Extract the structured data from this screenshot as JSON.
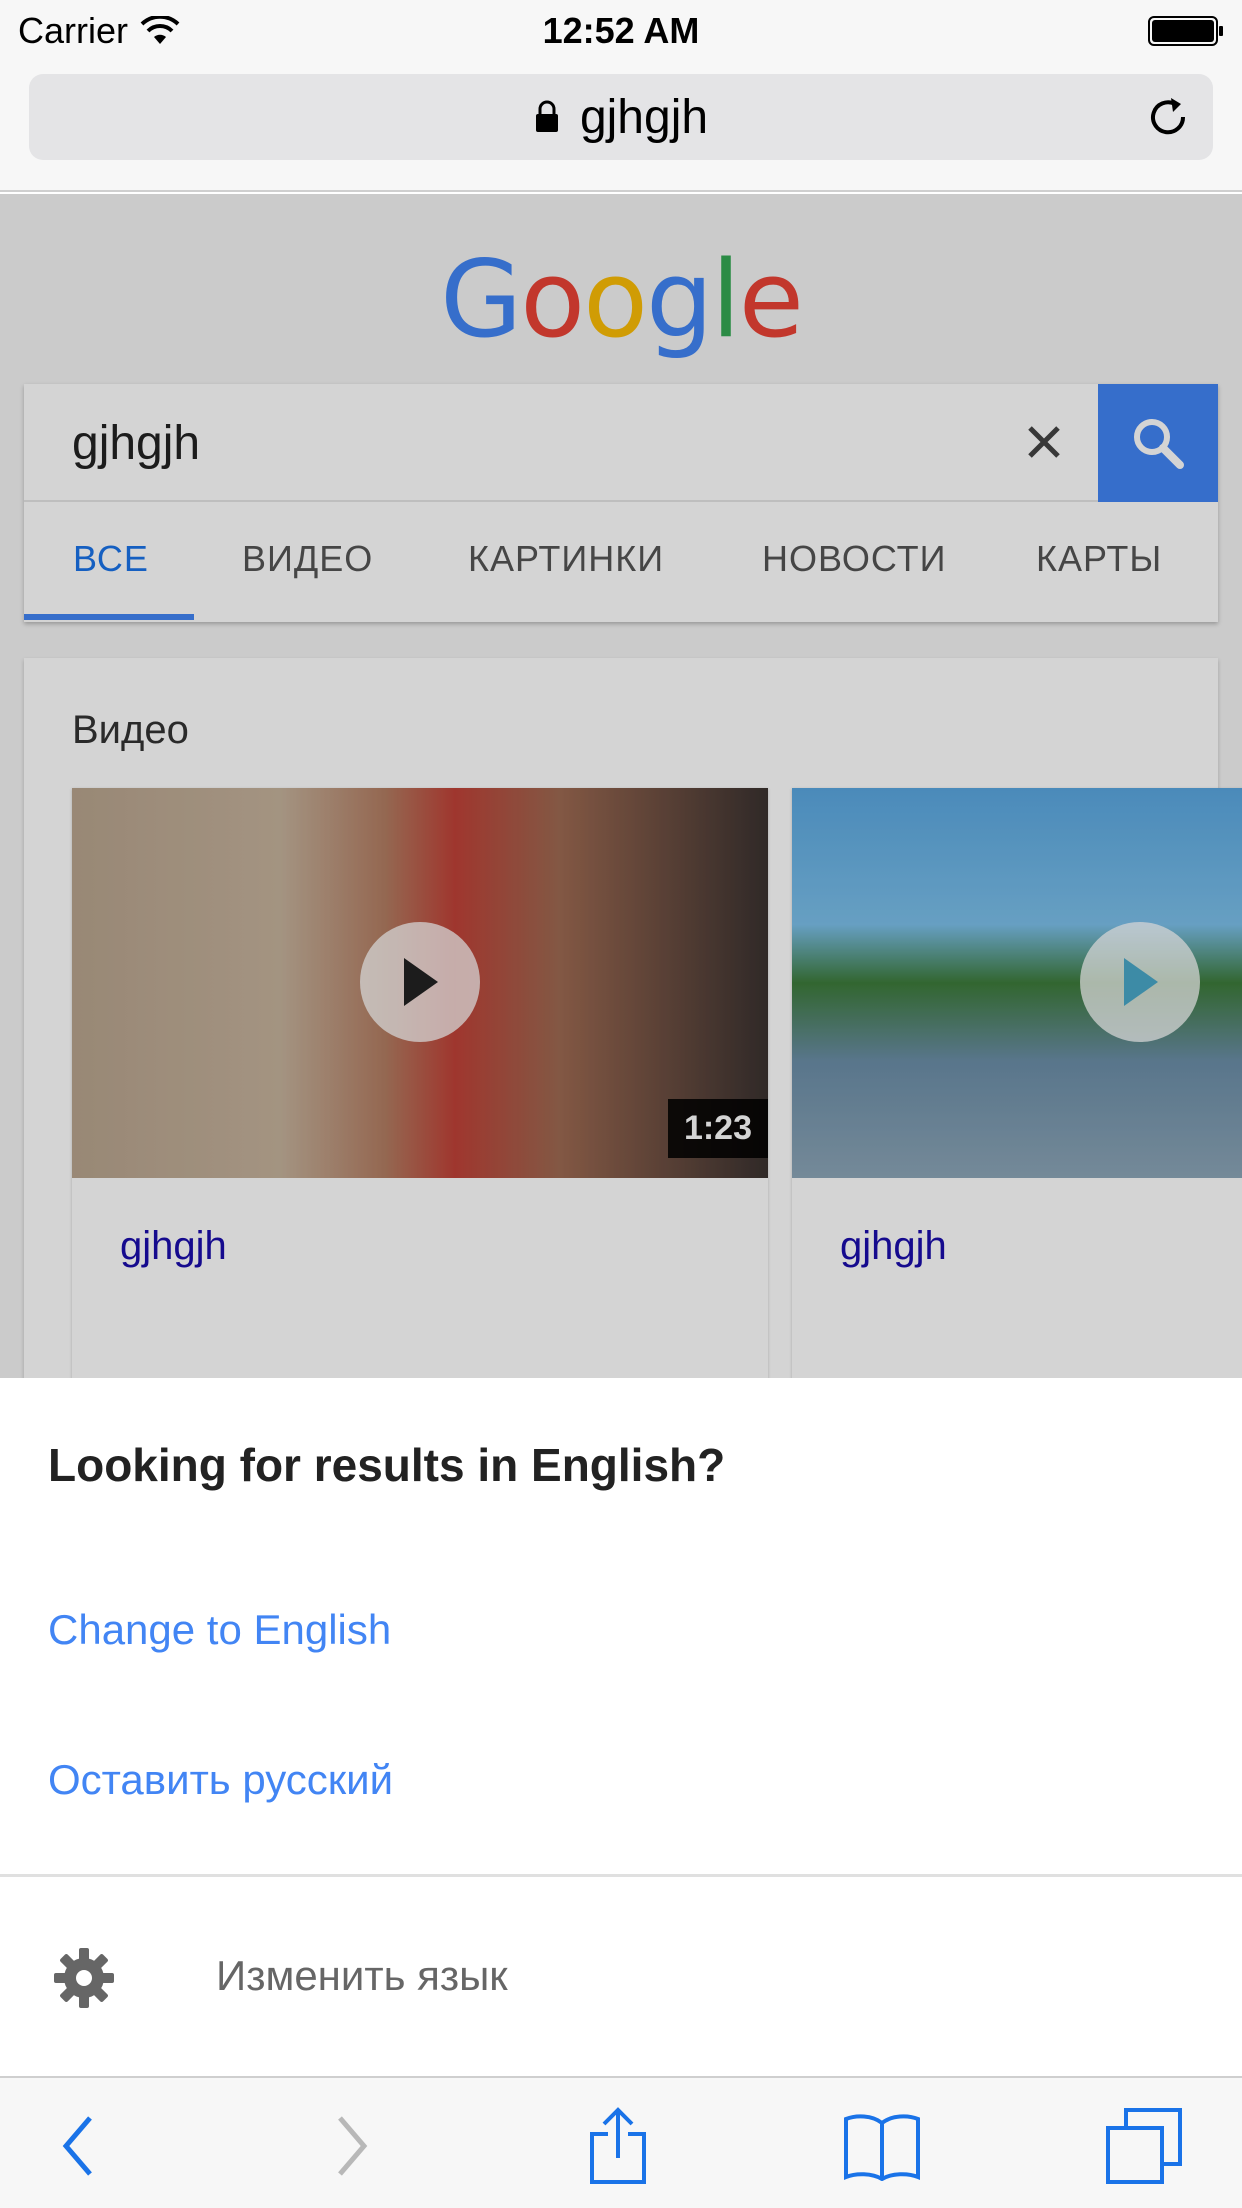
{
  "status_bar": {
    "carrier": "Carrier",
    "time": "12:52 AM"
  },
  "browser": {
    "url": "gjhgjh"
  },
  "google": {
    "logo_letters": [
      "G",
      "o",
      "o",
      "g",
      "l",
      "e"
    ],
    "search_value": "gjhgjh",
    "tabs": [
      {
        "label": "ВСЕ",
        "active": true
      },
      {
        "label": "ВИДЕО",
        "active": false
      },
      {
        "label": "КАРТИНКИ",
        "active": false
      },
      {
        "label": "НОВОСТИ",
        "active": false
      },
      {
        "label": "КАРТЫ",
        "active": false
      }
    ],
    "videos_heading": "Видео",
    "videos": [
      {
        "title": "gjhgjh",
        "duration": "1:23"
      },
      {
        "title": "gjhgjh",
        "duration": ""
      }
    ]
  },
  "language_sheet": {
    "title": "Looking for results in English?",
    "option_english": "Change to English",
    "option_keep": "Оставить русский",
    "change_language": "Изменить язык"
  },
  "colors": {
    "google_blue": "#4285f4",
    "link_blue": "#4285f4",
    "result_title": "#1a0dab"
  },
  "icons": [
    "wifi-icon",
    "battery-icon",
    "lock-icon",
    "reload-icon",
    "clear-icon",
    "search-icon",
    "play-icon",
    "gear-icon",
    "back-icon",
    "forward-icon",
    "share-icon",
    "bookmarks-icon",
    "tabs-icon"
  ]
}
